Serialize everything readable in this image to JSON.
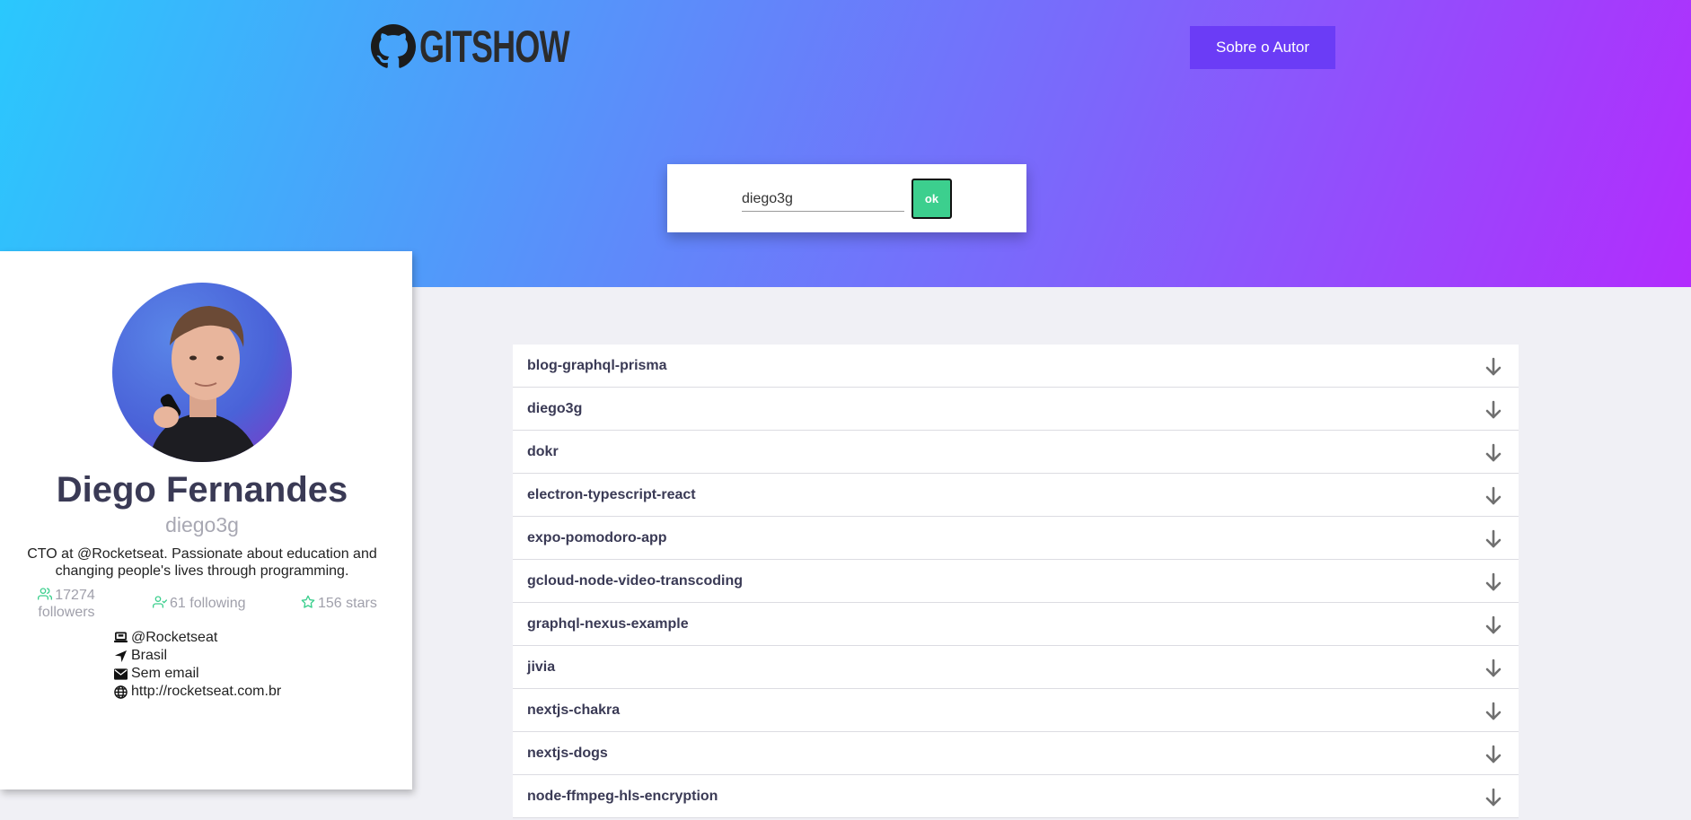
{
  "header": {
    "logo_text": "GITSHOW",
    "author_button": "Sobre o Autor"
  },
  "search": {
    "value": "diego3g",
    "button": "ok"
  },
  "profile": {
    "name": "Diego Fernandes",
    "login": "diego3g",
    "bio": "CTO at @Rocketseat. Passionate about education and changing people's lives through programming.",
    "followers": "17274 followers",
    "following": "61 following",
    "stars": "156 stars",
    "company": "@Rocketseat",
    "location": "Brasil",
    "email": "Sem email",
    "blog": "http://rocketseat.com.br"
  },
  "colors": {
    "accent_green": "#3ccf8e",
    "button_purple": "#6b3cf6",
    "title_dark": "#3a3a55"
  },
  "repos": [
    "blog-graphql-prisma",
    "diego3g",
    "dokr",
    "electron-typescript-react",
    "expo-pomodoro-app",
    "gcloud-node-video-transcoding",
    "graphql-nexus-example",
    "jivia",
    "nextjs-chakra",
    "nextjs-dogs",
    "node-ffmpeg-hls-encryption"
  ]
}
